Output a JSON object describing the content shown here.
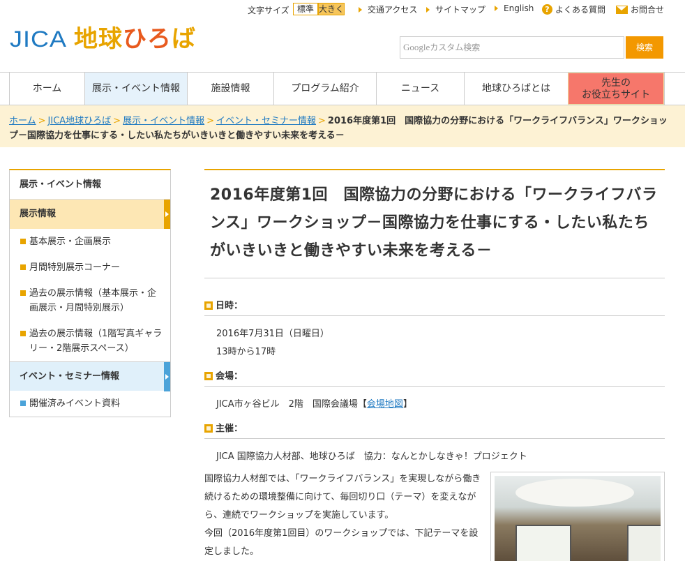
{
  "utility": {
    "font_size_label": "文字サイズ",
    "font_std": "標準",
    "font_big": "大きく",
    "links": [
      "交通アクセス",
      "サイトマップ",
      "English",
      "よくある質問",
      "お問合せ"
    ]
  },
  "logo": {
    "jica": "JICA",
    "hiroba": [
      "地",
      "球",
      "ひ",
      "ろ",
      "ば"
    ]
  },
  "search": {
    "google": "Google",
    "placeholder": "カスタム検索",
    "button": "検索"
  },
  "nav": {
    "items": [
      "ホーム",
      "展示・イベント情報",
      "施設情報",
      "プログラム紹介",
      "ニュース",
      "地球ひろばとは"
    ],
    "sensei_line1": "先生の",
    "sensei_line2": "お役立ちサイト"
  },
  "breadcrumb": {
    "links": [
      "ホーム",
      "JICA地球ひろば",
      "展示・イベント情報",
      "イベント・セミナー情報"
    ],
    "current": "2016年度第1回　国際協力の分野における「ワークライフバランス」ワークショップ－国際協力を仕事にする・したい私たちがいきいきと働きやすい未来を考える－"
  },
  "side": {
    "head": "展示・イベント情報",
    "cat1": "展示情報",
    "cat1_items": [
      "基本展示・企画展示",
      "月間特別展示コーナー",
      "過去の展示情報（基本展示・企画展示・月間特別展示）",
      "過去の展示情報（1階写真ギャラリー・2階展示スペース）"
    ],
    "cat2": "イベント・セミナー情報",
    "cat2_items": [
      "開催済みイベント資料"
    ]
  },
  "main": {
    "title": "2016年度第1回　国際協力の分野における「ワークライフバランス」ワークショップ－国際協力を仕事にする・したい私たちがいきいきと働きやすい未来を考える－",
    "date_label": "日時：",
    "date_line1": "2016年7月31日（日曜日）",
    "date_line2": "13時から17時",
    "venue_label": "会場：",
    "venue_text": "JICA市ヶ谷ビル　2階　国際会議場【",
    "venue_link": "会場地図",
    "venue_end": "】",
    "host_label": "主催：",
    "host_text": "JICA 国際協力人材部、地球ひろば　協力：なんとかしなきゃ！プロジェクト",
    "body1": "国際協力人材部では、「ワークライフバランス」を実現しながら働き続けるための環境整備に向けて、毎回切り口（テーマ）を変えながら、連続でワークショップを実施しています。",
    "body2": "今回（2016年度第1回目）のワークショップでは、下記テーマを設定しました。"
  }
}
